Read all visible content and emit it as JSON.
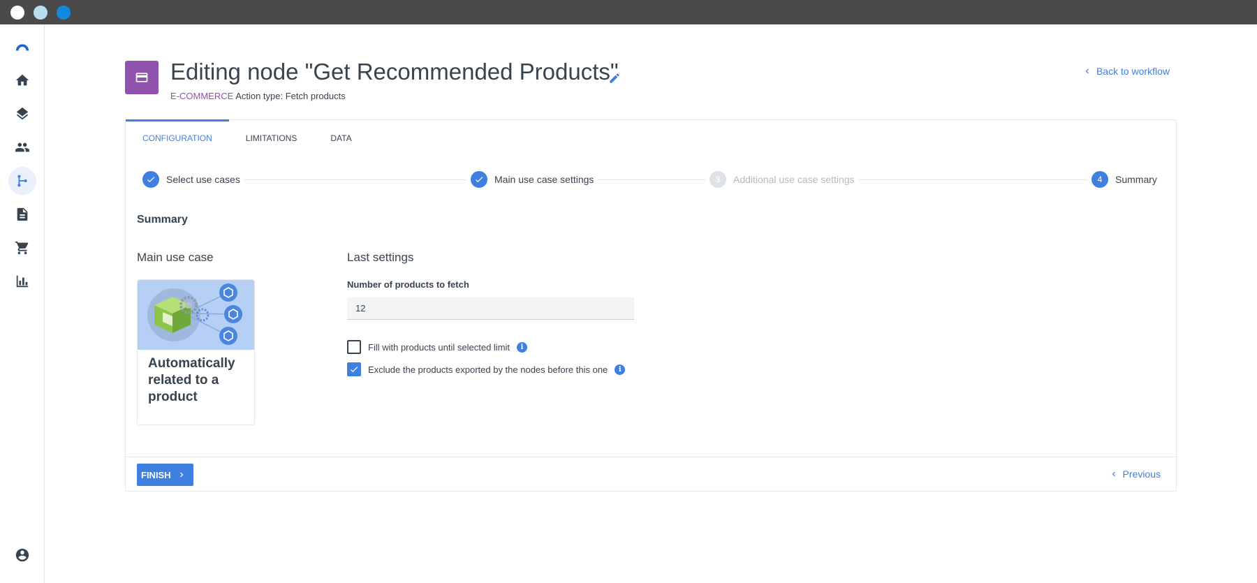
{
  "colors": {
    "accent": "#3f7fe0",
    "category": "#8f52ad",
    "text": "#384350",
    "muted": "#b2b9c2"
  },
  "window": {
    "controls": [
      "close",
      "minimize",
      "maximize"
    ]
  },
  "sidebar": {
    "items": [
      {
        "icon": "logo-icon"
      },
      {
        "icon": "home-icon"
      },
      {
        "icon": "layers-icon"
      },
      {
        "icon": "people-icon"
      },
      {
        "icon": "workflow-icon",
        "active": true
      },
      {
        "icon": "document-icon"
      },
      {
        "icon": "cart-icon"
      },
      {
        "icon": "bar-chart-icon"
      },
      {
        "icon": "account-icon"
      }
    ]
  },
  "header": {
    "title": "Editing node \"Get Recommended Products\"",
    "category": "E-COMMERCE",
    "action_type": "Action type: Fetch products",
    "back_link": "Back to workflow"
  },
  "tabs": [
    {
      "label": "CONFIGURATION",
      "active": true
    },
    {
      "label": "LIMITATIONS"
    },
    {
      "label": "DATA"
    }
  ],
  "stepper": {
    "steps": [
      {
        "label": "Select use cases",
        "state": "done"
      },
      {
        "label": "Main use case settings",
        "state": "done"
      },
      {
        "number": "3",
        "label": "Additional use case settings",
        "state": "disabled"
      },
      {
        "number": "4",
        "label": "Summary",
        "state": "current"
      }
    ]
  },
  "summary": {
    "title": "Summary",
    "main_use_case_title": "Main use case",
    "use_case_label": "Automatically related to a product",
    "last_settings_title": "Last settings",
    "products_field_label": "Number of products to fetch",
    "products_value": "12",
    "fill_label": "Fill with products until selected limit",
    "fill_checked": false,
    "exclude_label": "Exclude the products exported by the nodes before this one",
    "exclude_checked": true,
    "info_glyph": "i"
  },
  "footer": {
    "finish_label": "FINISH",
    "previous_label": "Previous"
  }
}
